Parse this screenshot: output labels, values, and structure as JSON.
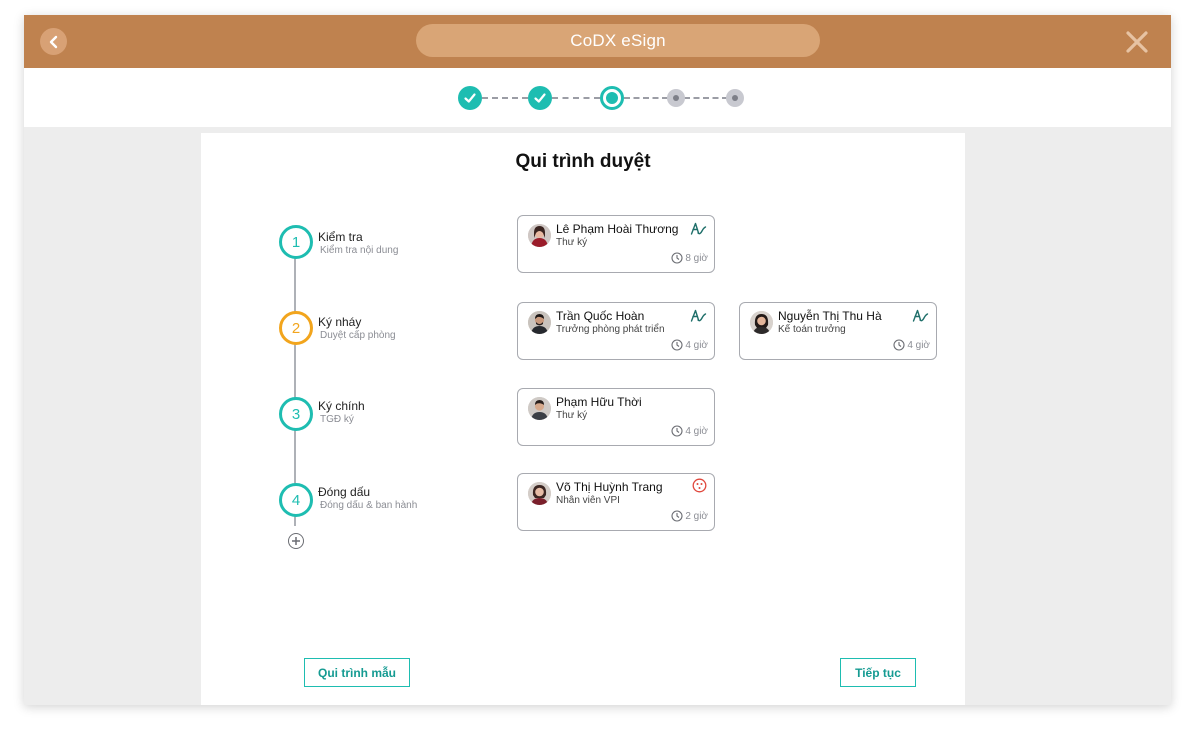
{
  "header": {
    "app_title": "CoDX eSign"
  },
  "panel": {
    "title": "Qui trình duyệt"
  },
  "stages": [
    {
      "number": "1",
      "title": "Kiểm tra",
      "subtitle": "Kiểm tra nội dung"
    },
    {
      "number": "2",
      "title": "Ký nháy",
      "subtitle": "Duyệt cấp phòng"
    },
    {
      "number": "3",
      "title": "Ký chính",
      "subtitle": "TGĐ ký"
    },
    {
      "number": "4",
      "title": "Đóng dấu",
      "subtitle": "Đóng dấu & ban hành"
    }
  ],
  "cards": [
    {
      "name": "Lê Phạm Hoài Thương",
      "role": "Thư ký",
      "time": "8 giờ",
      "action_icon": "signature-icon"
    },
    {
      "name": "Trần Quốc Hoàn",
      "role": "Trưởng phòng phát triển",
      "time": "4 giờ",
      "action_icon": "signature-icon"
    },
    {
      "name": "Nguyễn Thị Thu Hà",
      "role": "Kế toán trưởng",
      "time": "4 giờ",
      "action_icon": "signature-icon"
    },
    {
      "name": "Phạm Hữu Thời",
      "role": "Thư ký",
      "time": "4 giờ",
      "action_icon": ""
    },
    {
      "name": "Võ Thị Huỳnh Trang",
      "role": "Nhân viên VPI",
      "time": "2 giờ",
      "action_icon": "stamp-icon"
    }
  ],
  "buttons": {
    "template_label": "Qui trình mẫu",
    "continue_label": "Tiếp tục"
  },
  "colors": {
    "header": "#bf824f",
    "accent": "#1ebdb1",
    "stage_active": "#f2a51d",
    "stamp": "#e0473c"
  }
}
